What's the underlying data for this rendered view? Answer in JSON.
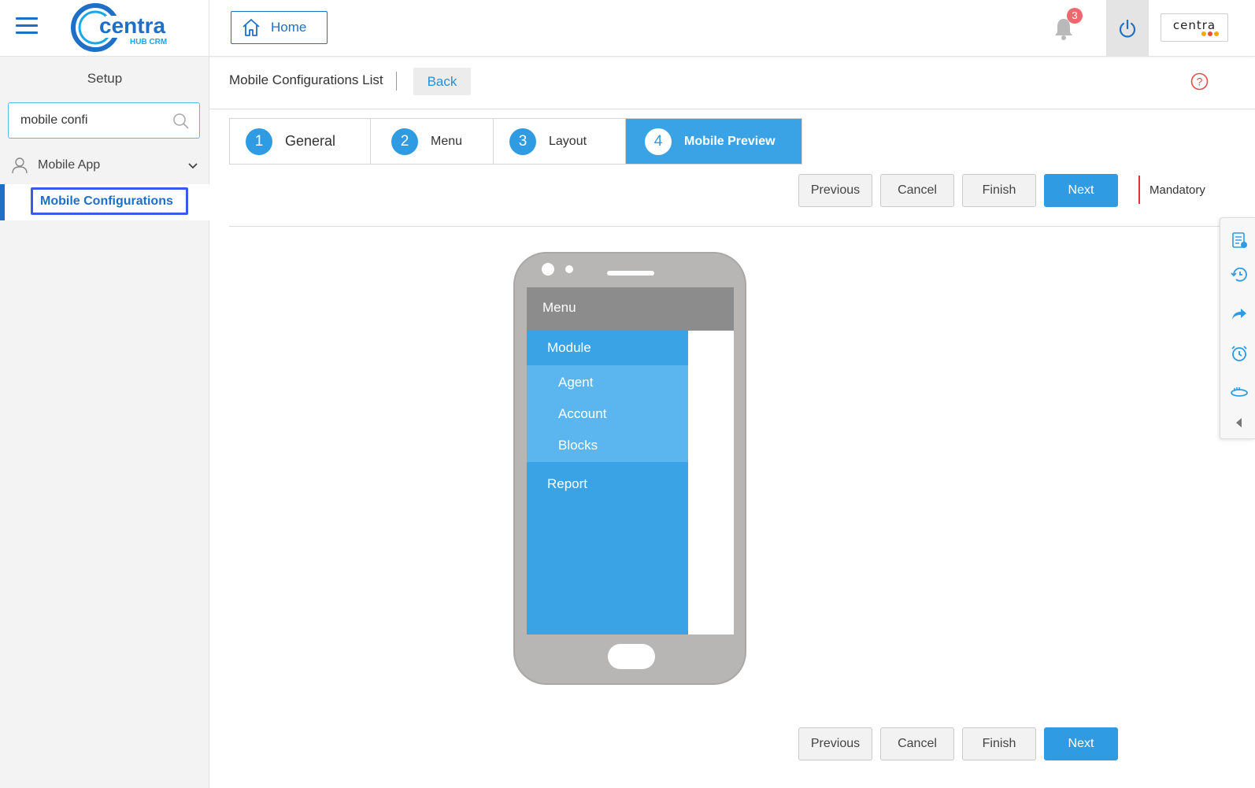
{
  "header": {
    "logo_text": "centra",
    "logo_sub": "HUB CRM",
    "home_label": "Home",
    "notification_count": "3",
    "brand_text": "centra",
    "brand_dot_colors": [
      "#f2a900",
      "#e94b3c",
      "#f2a900"
    ]
  },
  "sidebar": {
    "title": "Setup",
    "search_value": "mobile confi",
    "group_label": "Mobile App",
    "active_item": "Mobile Configurations"
  },
  "breadcrumb": {
    "title": "Mobile Configurations List",
    "back_label": "Back"
  },
  "wizard": {
    "steps": [
      {
        "num": "1",
        "label": "General"
      },
      {
        "num": "2",
        "label": "Menu"
      },
      {
        "num": "3",
        "label": "Layout"
      },
      {
        "num": "4",
        "label": "Mobile Preview"
      }
    ],
    "active_step": 4
  },
  "actions": {
    "previous": "Previous",
    "cancel": "Cancel",
    "finish": "Finish",
    "next": "Next",
    "mandatory": "Mandatory"
  },
  "preview": {
    "header": "Menu",
    "module": "Module",
    "sub_items": [
      "Agent",
      "Account",
      "Blocks"
    ],
    "report": "Report"
  },
  "colors": {
    "accent": "#2e9be3",
    "brand_blue": "#1e6fc7",
    "menu_blue": "#3aa3e6",
    "submenu_blue": "#5bb6ef",
    "mandatory_red": "#e0353b"
  },
  "right_toolbar": [
    "notes-icon",
    "history-icon",
    "share-icon",
    "alarm-icon",
    "view-360-icon",
    "collapse-icon"
  ]
}
